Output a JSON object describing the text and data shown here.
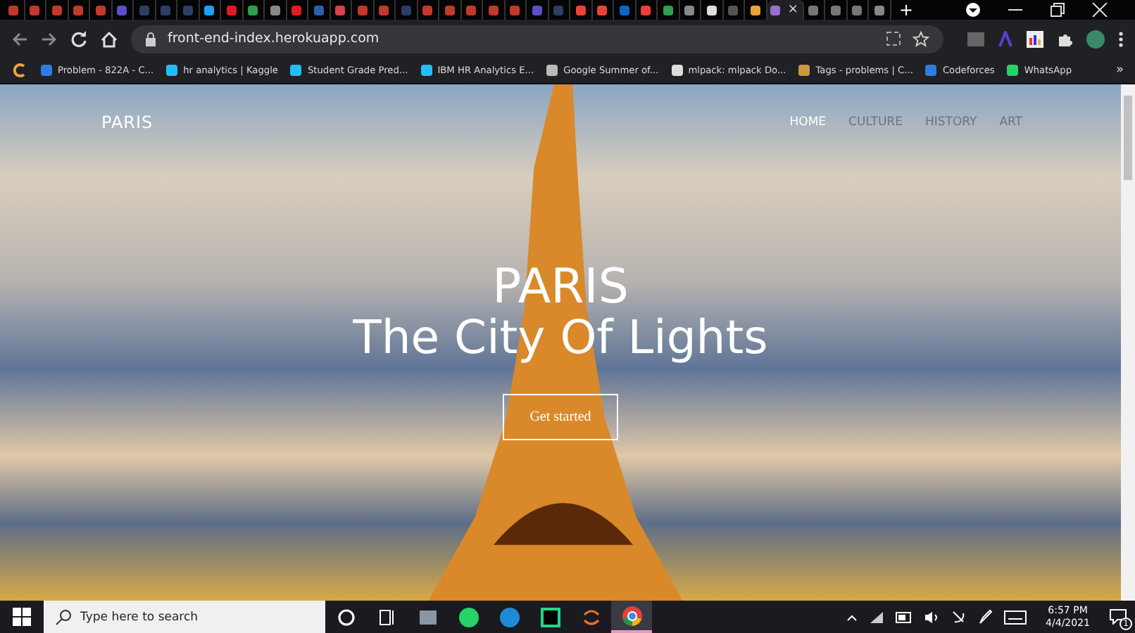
{
  "browser": {
    "tabs": [
      {
        "color": "#c0392b",
        "selected": false
      },
      {
        "color": "#c0392b",
        "selected": false
      },
      {
        "color": "#c0392b",
        "selected": false
      },
      {
        "color": "#c0392b",
        "selected": false
      },
      {
        "color": "#c0392b",
        "selected": false
      },
      {
        "color": "#5b4fc7",
        "selected": false
      },
      {
        "color": "#2c3e66",
        "selected": false
      },
      {
        "color": "#2c3e66",
        "selected": false
      },
      {
        "color": "#2c3e66",
        "selected": false
      },
      {
        "color": "#1da1f2",
        "selected": false
      },
      {
        "color": "#e0192a",
        "selected": false
      },
      {
        "color": "#2e9e4f",
        "selected": false
      },
      {
        "color": "#888888",
        "selected": false
      },
      {
        "color": "#e31b23",
        "selected": false
      },
      {
        "color": "#2d5fa8",
        "selected": false
      },
      {
        "color": "#d64545",
        "selected": false
      },
      {
        "color": "#c0392b",
        "selected": false
      },
      {
        "color": "#c0392b",
        "selected": false
      },
      {
        "color": "#2c3e66",
        "selected": false
      },
      {
        "color": "#c0392b",
        "selected": false
      },
      {
        "color": "#c0392b",
        "selected": false
      },
      {
        "color": "#c0392b",
        "selected": false
      },
      {
        "color": "#c0392b",
        "selected": false
      },
      {
        "color": "#c0392b",
        "selected": false
      },
      {
        "color": "#5b4fc7",
        "selected": false
      },
      {
        "color": "#2c3e66",
        "selected": false
      },
      {
        "color": "#ea4335",
        "selected": false
      },
      {
        "color": "#ea4335",
        "selected": false
      },
      {
        "color": "#0a66c2",
        "selected": false
      },
      {
        "color": "#ea4335",
        "selected": false
      },
      {
        "color": "#2e9e4f",
        "selected": false
      },
      {
        "color": "#888888",
        "selected": false
      },
      {
        "color": "#dddddd",
        "selected": false
      },
      {
        "color": "#555555",
        "selected": false
      },
      {
        "color": "#e8a33d",
        "selected": false
      },
      {
        "color": "#9b6fd0",
        "selected": true
      },
      {
        "color": "#777777",
        "selected": false
      },
      {
        "color": "#777777",
        "selected": false
      },
      {
        "color": "#777777",
        "selected": false
      },
      {
        "color": "#888888",
        "selected": false
      }
    ],
    "close_tab": "×",
    "new_tab": "+",
    "url": "front-end-index.herokuapp.com",
    "apps_icon": {
      "color": "#e8a33d"
    },
    "bookmarks": [
      {
        "label": "Problem - 822A - C...",
        "color": "#2f7de1"
      },
      {
        "label": "hr analytics | Kaggle",
        "color": "#20beff"
      },
      {
        "label": "Student Grade Pred...",
        "color": "#20beff"
      },
      {
        "label": "IBM HR Analytics E...",
        "color": "#20beff"
      },
      {
        "label": "Google Summer of...",
        "color": "#bbbbbb"
      },
      {
        "label": "mlpack: mlpack Do...",
        "color": "#dddddd"
      },
      {
        "label": "Tags - problems | C...",
        "color": "#c99a3a"
      },
      {
        "label": "Codeforces",
        "color": "#2f7de1"
      },
      {
        "label": "WhatsApp",
        "color": "#25d366"
      }
    ],
    "more": "»"
  },
  "page": {
    "brand": "PARIS",
    "nav": [
      {
        "label": "HOME",
        "selected": true
      },
      {
        "label": "CULTURE",
        "selected": false
      },
      {
        "label": "HISTORY",
        "selected": false
      },
      {
        "label": "ART",
        "selected": false
      }
    ],
    "title": "PARIS",
    "subtitle": "The City Of Lights",
    "cta": "Get started"
  },
  "taskbar": {
    "search_placeholder": "Type here to search",
    "apps": [
      {
        "kind": "cortana",
        "active": false
      },
      {
        "kind": "taskview",
        "active": false
      },
      {
        "kind": "laptop",
        "active": false
      },
      {
        "kind": "whatsapp",
        "active": false
      },
      {
        "kind": "edge",
        "active": false
      },
      {
        "kind": "pycharm",
        "active": false
      },
      {
        "kind": "sync",
        "active": false
      },
      {
        "kind": "chrome",
        "active": true
      }
    ],
    "time": "6:57 PM",
    "date": "4/4/2021",
    "notifications": "1"
  }
}
